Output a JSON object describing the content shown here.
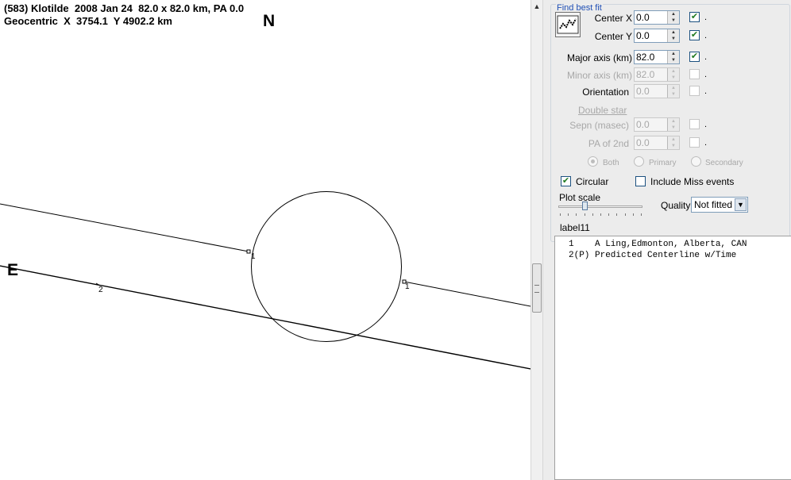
{
  "plot": {
    "header_line1": "(583) Klotilde  2008 Jan 24  82.0 x 82.0 km, PA 0.0",
    "header_line2": "Geocentric  X  3754.1  Y 4902.2 km",
    "north_label": "N",
    "east_label": "E",
    "chord_labels": [
      "1",
      "1",
      "2"
    ]
  },
  "panel": {
    "group_title": "Find best fit",
    "fit_button_icon": "chart-fit-icon",
    "center_x": {
      "label": "Center X",
      "value": "0.0",
      "checked": true
    },
    "center_y": {
      "label": "Center Y",
      "value": "0.0",
      "checked": true
    },
    "major_axis": {
      "label": "Major axis (km)",
      "value": "82.0",
      "checked": true
    },
    "minor_axis": {
      "label": "Minor axis (km)",
      "value": "82.0",
      "checked": false,
      "disabled": true
    },
    "orientation": {
      "label": "Orientation",
      "value": "0.0",
      "checked": false,
      "disabled": true
    },
    "check_suffix": ".",
    "double_star_label": "Double star",
    "sepn": {
      "label": "Sepn (masec)",
      "value": "0.0",
      "checked": false,
      "disabled": true
    },
    "pa_2nd": {
      "label": "PA of 2nd",
      "value": "0.0",
      "checked": false,
      "disabled": true
    },
    "radio_options": [
      "Both",
      "Primary",
      "Secondary"
    ],
    "radio_selected": "Both",
    "circular_label": "Circular",
    "circular_checked": true,
    "include_miss_label": "Include Miss events",
    "include_miss_checked": false,
    "plot_scale_label": "Plot scale",
    "plot_scale_level": 0.3,
    "quality_label": "Quality",
    "quality_value": "Not fitted",
    "list_label": "label11",
    "list_items": [
      "1    A Ling,Edmonton, Alberta, CAN",
      "2(P) Predicted Centerline w/Time"
    ]
  },
  "colors": {
    "legend": "#1f4fb5",
    "check": "#217a21",
    "panel_bg": "#ececec"
  }
}
